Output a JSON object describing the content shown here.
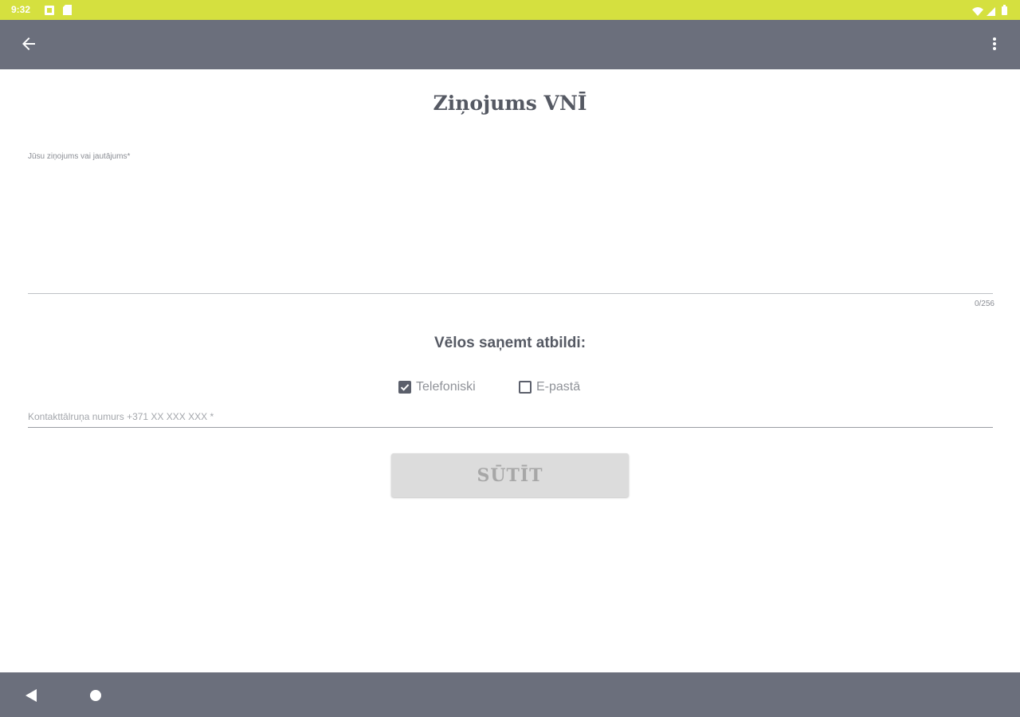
{
  "status_bar": {
    "time": "9:32",
    "left_icons": [
      "notification-icon",
      "sd-card-icon"
    ],
    "right_icons": [
      "wifi-icon",
      "signal-icon",
      "battery-icon"
    ],
    "color": "#d5e03f"
  },
  "app_bar": {
    "color": "#6b6f7c",
    "back_icon": "arrow-back-icon",
    "menu_icon": "more-vert-icon"
  },
  "form": {
    "title": "Ziņojums VNĪ",
    "message_label": "Jūsu ziņojums vai jautājums*",
    "message_value": "",
    "char_counter": "0/256",
    "reply_heading": "Vēlos saņemt atbildi:",
    "options": [
      {
        "label": "Telefoniski",
        "checked": true
      },
      {
        "label": "E-pastā",
        "checked": false
      }
    ],
    "phone_placeholder": "Kontakttālruņa numurs +371 XX XXX XXX *",
    "phone_value": "",
    "send_label": "SŪTĪT"
  },
  "nav_bar": {
    "color": "#6b6f7c",
    "icons": [
      "nav-back-icon",
      "nav-home-icon"
    ]
  }
}
